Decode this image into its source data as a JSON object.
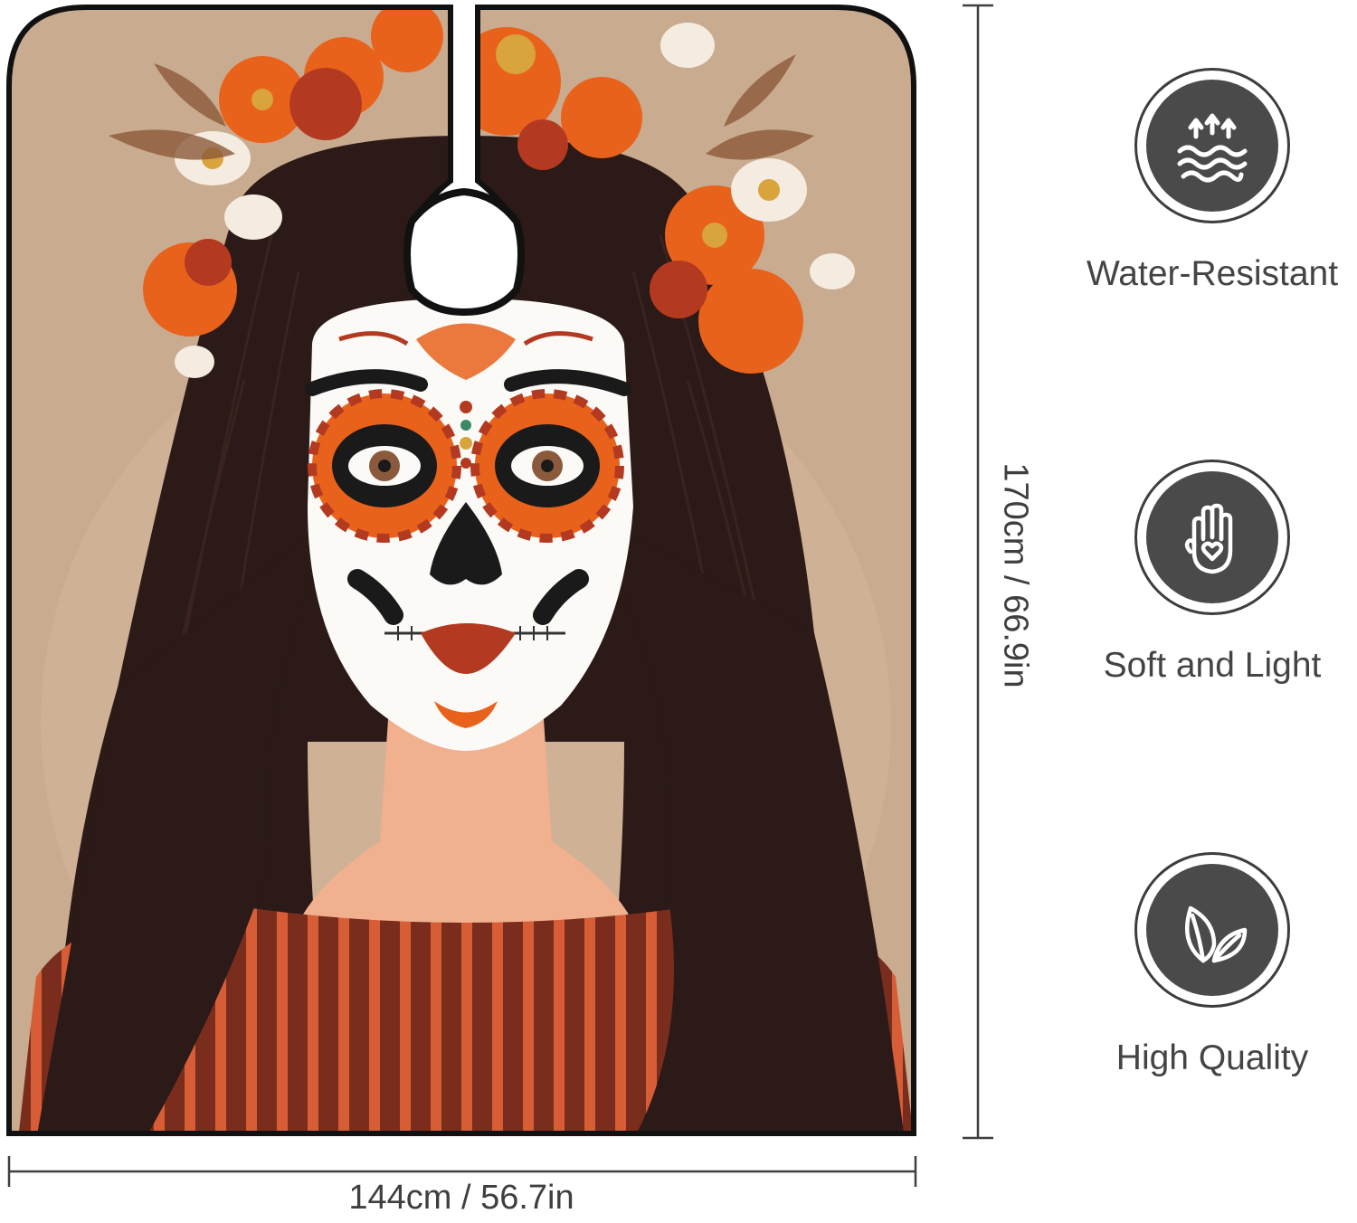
{
  "product": {
    "artwork": "sugar-skull-woman-with-flower-crown",
    "colors": {
      "background": "#c9ab8f",
      "hair": "#2b1a17",
      "skin": "#f1b08e",
      "face_paint": "#fbfaf7",
      "accent_orange": "#e8621c",
      "accent_red": "#b33a21",
      "dress_dark": "#7a2d1c",
      "dress_stripe": "#d65d36",
      "outline": "#111111"
    }
  },
  "dimensions": {
    "width_label": "144cm / 56.7in",
    "height_label": "170cm / 66.9in"
  },
  "features": [
    {
      "label": "Water-Resistant",
      "icon": "water-resistant-icon"
    },
    {
      "label": "Soft and Light",
      "icon": "soft-hand-heart-icon"
    },
    {
      "label": "High Quality",
      "icon": "leaf-icon"
    }
  ],
  "icon_colors": {
    "circle_fill": "#4a4a4a",
    "circle_ring": "#3d3d3d",
    "glyph": "#ffffff"
  }
}
